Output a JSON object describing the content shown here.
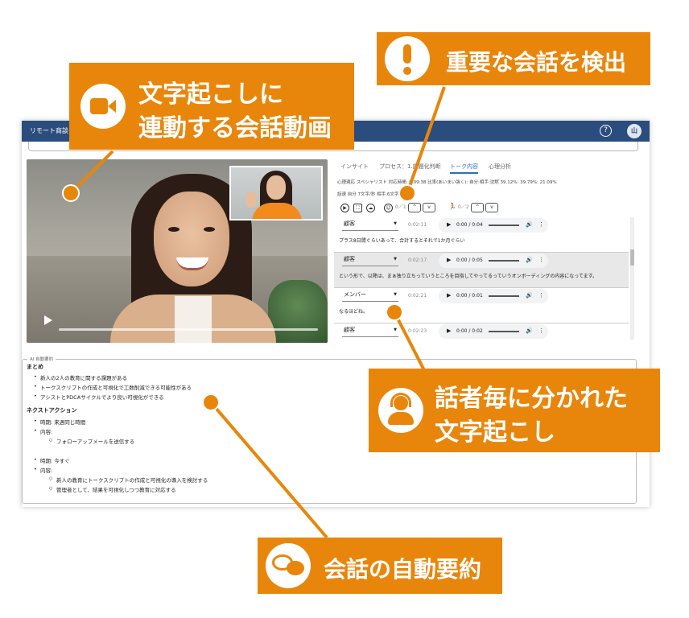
{
  "app": {
    "title": "リモート商談",
    "help_icon": "?",
    "avatar_initial": "山"
  },
  "tabs": [
    "インサイト",
    "プロセス：1.課題化判断",
    "トーク内容",
    "心理分析"
  ],
  "active_tab": 2,
  "stats": {
    "line1": "心理適応  スペシャリスト  対応時間: 0:09:38  比率(あいまい強く): 自分:相手:沈黙 39.12%: 39.79%: 21.09%",
    "line2": "話速  自分 7文字/秒  相手 6文字/秒"
  },
  "controls": {
    "counter1": "0／1",
    "counter2": "0／2",
    "up": "^",
    "down": "v"
  },
  "transcript": [
    {
      "speaker": "顧客",
      "time": "0:02:11",
      "audio": "0:00 / 0:04",
      "text": "プラス8日間ぐらいあって、合計するとそれで1か月ぐらい"
    },
    {
      "speaker": "顧客",
      "time": "0:02:17",
      "audio": "0:00 / 0:05",
      "text": "という形で、以降は、まぁ独り立ちっていうところを目指してやってるっていうオンボーディングの内容になってます。"
    },
    {
      "speaker": "メンバー",
      "time": "0:02:21",
      "audio": "0:00 / 0:01",
      "text": "なるほどね。"
    },
    {
      "speaker": "顧客",
      "time": "0:02:23",
      "audio": "0:00 / 0:02",
      "text": ""
    }
  ],
  "summary": {
    "legend": "AI 自動要約",
    "heading_matome": "まとめ",
    "matome_items": [
      "新人の2人の教育に関する課題がある",
      "トークスクリプトの作成と可視化で工数削減できる可能性がある",
      "アシストとPDCAサイクルでより良い可視化ができる"
    ],
    "heading_next": "ネクストアクション",
    "next1_time": "時期: 来週同じ時間",
    "next1_content_label": "内容:",
    "next1_sub": "フォローアップメールを送信する",
    "next2_time": "時期: 今すぐ",
    "next2_content_label": "内容:",
    "next2_sub1": "新人の教育にトークスクリプトの作成と可視化の導入を検討する",
    "next2_sub2": "管理者として、結果を可視化しつつ教育に対応する"
  },
  "callouts": {
    "video_line1": "文字起こしに",
    "video_line2": "連動する会話動画",
    "important": "重要な会話を検出",
    "speaker_line1": "話者毎に分かれた",
    "speaker_line2": "文字起こし",
    "summary": "会話の自動要約"
  },
  "colors": {
    "accent_orange": "#e8860b",
    "topbar_blue": "#2a4d7e",
    "tab_active": "#2a6fc4"
  }
}
